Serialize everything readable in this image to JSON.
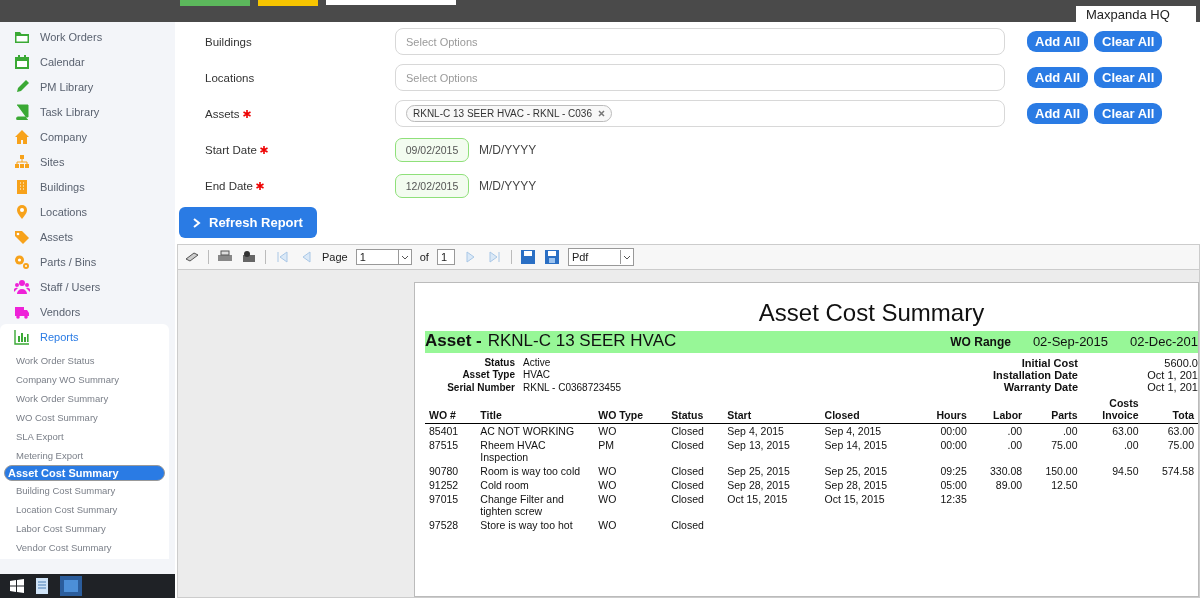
{
  "top_bar": {
    "site": "Maxpanda HQ"
  },
  "sidebar": {
    "items": [
      {
        "label": "Work Orders",
        "color": "#3aa935"
      },
      {
        "label": "Calendar",
        "color": "#3aa935"
      },
      {
        "label": "PM Library",
        "color": "#3aa935"
      },
      {
        "label": "Task Library",
        "color": "#3aa935"
      },
      {
        "label": "Company",
        "color": "#f7a21b"
      },
      {
        "label": "Sites",
        "color": "#f7a21b"
      },
      {
        "label": "Buildings",
        "color": "#f7a21b"
      },
      {
        "label": "Locations",
        "color": "#f7a21b"
      },
      {
        "label": "Assets",
        "color": "#f7a21b"
      },
      {
        "label": "Parts / Bins",
        "color": "#f7a21b"
      },
      {
        "label": "Staff / Users",
        "color": "#ee22d8"
      },
      {
        "label": "Vendors",
        "color": "#ee22d8"
      },
      {
        "label": "Reports",
        "color": "#3aa935",
        "expanded": true,
        "children": [
          {
            "label": "Work Order Status",
            "selected": false
          },
          {
            "label": "Company WO Summary",
            "selected": false
          },
          {
            "label": "Work Order Summary",
            "selected": false
          },
          {
            "label": "WO Cost Summary",
            "selected": false
          },
          {
            "label": "SLA Export",
            "selected": false
          },
          {
            "label": "Metering Export",
            "selected": false
          },
          {
            "label": "Asset Cost Summary",
            "selected": true
          },
          {
            "label": "Building Cost Summary",
            "selected": false
          },
          {
            "label": "Location Cost Summary",
            "selected": false
          },
          {
            "label": "Labor Cost Summary",
            "selected": false
          },
          {
            "label": "Vendor Cost Summary",
            "selected": false
          }
        ]
      }
    ]
  },
  "filters": [
    {
      "kind": "select",
      "label": "Buildings",
      "required": false,
      "placeholder": "Select Options",
      "buttons": [
        "Add All",
        "Clear All"
      ]
    },
    {
      "kind": "select",
      "label": "Locations",
      "required": false,
      "placeholder": "Select Options",
      "buttons": [
        "Add All",
        "Clear All"
      ]
    },
    {
      "kind": "tags",
      "label": "Assets",
      "required": true,
      "tags": [
        "RKNL-C 13 SEER HVAC - RKNL - C036"
      ],
      "buttons": [
        "Add All",
        "Clear All"
      ]
    },
    {
      "kind": "date",
      "label": "Start Date",
      "required": true,
      "value": "09/02/2015",
      "hint": "M/D/YYYY"
    },
    {
      "kind": "date",
      "label": "End Date",
      "required": true,
      "value": "12/02/2015",
      "hint": "M/D/YYYY"
    }
  ],
  "refresh_button": "Refresh Report",
  "viewer_toolbar": {
    "page_label": "Page",
    "page": "1",
    "of_label": "of",
    "page_count": "1",
    "format": "Pdf"
  },
  "report": {
    "title": "Asset Cost Summary",
    "asset_label": "Asset -",
    "asset_name": "RKNL-C 13 SEER HVAC",
    "range_label": "WO Range",
    "range_start": "02-Sep-2015",
    "range_end": "02-Dec-201",
    "details": [
      {
        "label": "Status",
        "value": "Active"
      },
      {
        "label": "Asset Type",
        "value": "HVAC"
      },
      {
        "label": "Serial Number",
        "value": "RKNL - C0368723455"
      }
    ],
    "cost_details": [
      {
        "label": "Initial Cost",
        "value": "5600.0"
      },
      {
        "label": "Installation Date",
        "value": "Oct 1, 201"
      },
      {
        "label": "Warranty Date",
        "value": "Oct 1, 201"
      }
    ],
    "group_header": "Costs",
    "columns": [
      "WO #",
      "Title",
      "WO Type",
      "Status",
      "Start",
      "Closed",
      "Hours",
      "Labor",
      "Parts",
      "Invoice",
      "Tota"
    ],
    "rows": [
      {
        "wo": "85401",
        "title": "AC NOT WORKING",
        "type": "WO",
        "status": "Closed",
        "start": "Sep 4, 2015",
        "closed": "Sep 4, 2015",
        "hours": "00:00",
        "labor": ".00",
        "parts": ".00",
        "invoice": "63.00",
        "total": "63.00"
      },
      {
        "wo": "87515",
        "title": "Rheem HVAC Inspection",
        "type": "PM",
        "status": "Closed",
        "start": "Sep 13, 2015",
        "closed": "Sep 14, 2015",
        "hours": "00:00",
        "labor": ".00",
        "parts": "75.00",
        "invoice": ".00",
        "total": "75.00"
      },
      {
        "wo": "90780",
        "title": "Room is way too cold",
        "type": "WO",
        "status": "Closed",
        "start": "Sep 25, 2015",
        "closed": "Sep 25, 2015",
        "hours": "09:25",
        "labor": "330.08",
        "parts": "150.00",
        "invoice": "94.50",
        "total": "574.58"
      },
      {
        "wo": "91252",
        "title": "Cold room",
        "type": "WO",
        "status": "Closed",
        "start": "Sep 28, 2015",
        "closed": "Sep 28, 2015",
        "hours": "05:00",
        "labor": "89.00",
        "parts": "12.50"
      },
      {
        "wo": "97015",
        "title": "Change Filter and tighten screw",
        "type": "WO",
        "status": "Closed",
        "start": "Oct 15, 2015",
        "closed": "Oct 15, 2015",
        "hours": "12:35"
      },
      {
        "wo": "97528",
        "title": "Store is way too hot",
        "type": "WO",
        "status": "Closed"
      }
    ]
  }
}
